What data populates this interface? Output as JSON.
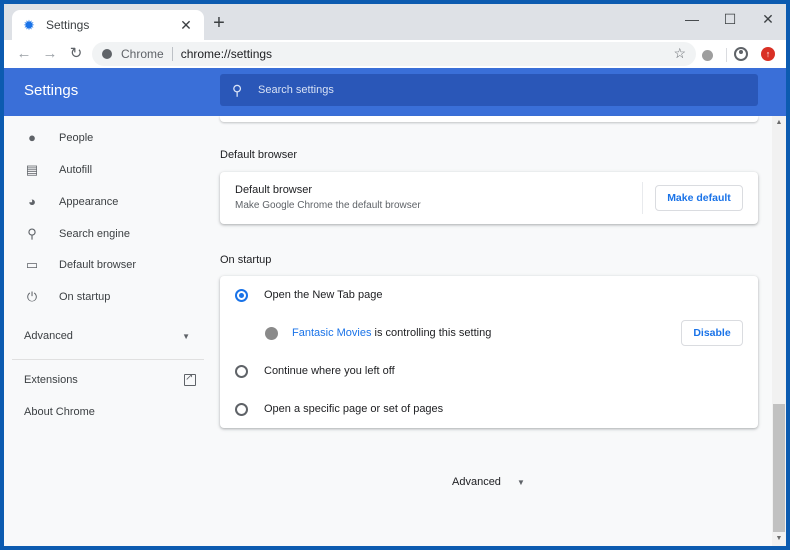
{
  "browser": {
    "tab": {
      "title": "Settings",
      "favicon": "gear-icon",
      "close": "✕"
    },
    "new_tab": "+",
    "window_controls": {
      "minimize": "—",
      "maximize": "☐",
      "close": "✕"
    },
    "toolbar": {
      "back": "←",
      "forward": "→",
      "reload": "↻",
      "site_chip": "Chrome",
      "url": "chrome://settings",
      "bookmark": "☆",
      "update_badge": "↑"
    }
  },
  "header": {
    "title": "Settings",
    "search_icon": "⚲",
    "search_placeholder": "Search settings"
  },
  "sidebar": {
    "items": [
      {
        "label": "People",
        "icon": "person-icon",
        "glyph": "👤"
      },
      {
        "label": "Autofill",
        "icon": "clipboard-icon",
        "glyph": "📋"
      },
      {
        "label": "Appearance",
        "icon": "palette-icon",
        "glyph": "🎨"
      },
      {
        "label": "Search engine",
        "icon": "search-icon",
        "glyph": "⚲"
      },
      {
        "label": "Default browser",
        "icon": "browser-icon",
        "glyph": "▭"
      },
      {
        "label": "On startup",
        "icon": "power-icon",
        "glyph": "⏻"
      }
    ],
    "advanced": {
      "label": "Advanced",
      "caret": "▼"
    },
    "extensions": "Extensions",
    "about": "About Chrome"
  },
  "main": {
    "default_browser": {
      "section_title": "Default browser",
      "row_title": "Default browser",
      "row_subtitle": "Make Google Chrome the default browser",
      "button": "Make default"
    },
    "on_startup": {
      "section_title": "On startup",
      "options": [
        {
          "label": "Open the New Tab page",
          "checked": true
        },
        {
          "label": "Continue where you left off",
          "checked": false
        },
        {
          "label": "Open a specific page or set of pages",
          "checked": false
        }
      ],
      "extension_notice": {
        "extension_name": "Fantasic Movies",
        "text": " is controlling this setting",
        "button": "Disable"
      }
    },
    "advanced": {
      "label": "Advanced",
      "caret": "▼"
    }
  },
  "colors": {
    "header_blue": "#3a6fd8",
    "search_blue": "#2a57b8",
    "accent": "#1a73e8",
    "update_red": "#d93025"
  },
  "scrollbar": {
    "up": "▲",
    "down": "▼"
  }
}
